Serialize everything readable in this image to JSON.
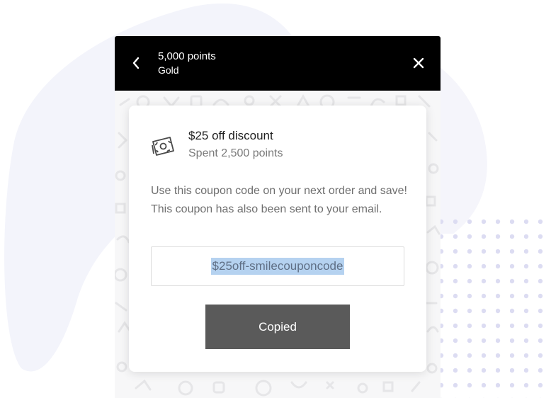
{
  "header": {
    "points": "5,000 points",
    "tier": "Gold",
    "background_color": "#000000"
  },
  "reward": {
    "icon": "money-icon",
    "title": "$25 off discount",
    "subtitle": "Spent 2,500 points"
  },
  "description": "Use this coupon code on your next order and save! This coupon has also been sent to your email.",
  "coupon": {
    "code": "$25off-smilecouponcode",
    "selected": true,
    "selection_color": "#b5d2f0"
  },
  "copy_button": {
    "label": "Copied",
    "color": "#5a5a5a"
  },
  "icons": {
    "back": "chevron-left-icon",
    "close": "close-icon"
  }
}
